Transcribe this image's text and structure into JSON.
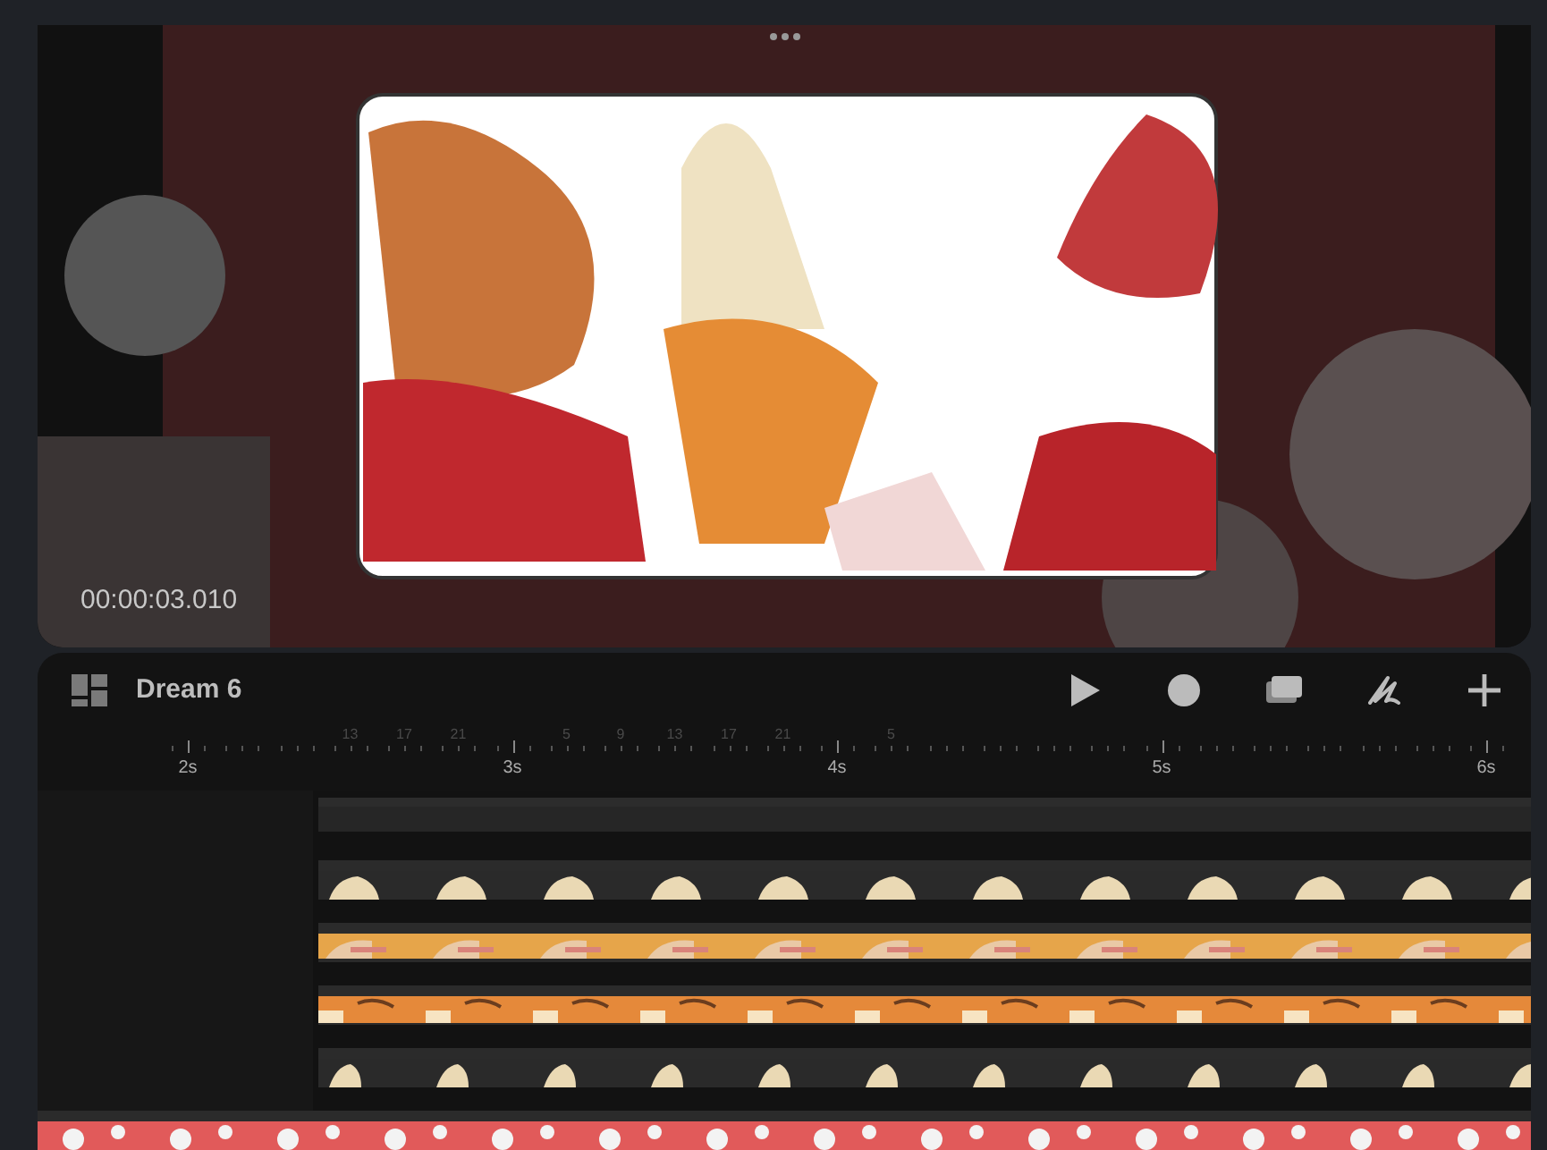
{
  "preview": {
    "timecode": "00:00:03.010"
  },
  "project": {
    "title": "Dream 6"
  },
  "toolbar": [
    {
      "kind": "play"
    },
    {
      "kind": "record"
    },
    {
      "kind": "layers"
    },
    {
      "kind": "draw"
    },
    {
      "kind": "add"
    }
  ],
  "ruler": [
    {
      "kind": "second",
      "label": "2s"
    },
    {
      "kind": "tick"
    },
    {
      "kind": "tick"
    },
    {
      "kind": "frame",
      "label": "13"
    },
    {
      "kind": "frame",
      "label": "17"
    },
    {
      "kind": "frame",
      "label": "21"
    },
    {
      "kind": "second",
      "label": "3s"
    },
    {
      "kind": "frame",
      "label": "5"
    },
    {
      "kind": "frame",
      "label": "9"
    },
    {
      "kind": "frame",
      "label": "13"
    },
    {
      "kind": "frame",
      "label": "17"
    },
    {
      "kind": "frame",
      "label": "21"
    },
    {
      "kind": "second",
      "label": "4s"
    },
    {
      "kind": "frame",
      "label": "5"
    },
    {
      "kind": "tick"
    },
    {
      "kind": "tick"
    },
    {
      "kind": "tick"
    },
    {
      "kind": "tick"
    },
    {
      "kind": "second",
      "label": "5s"
    },
    {
      "kind": "tick"
    },
    {
      "kind": "tick"
    },
    {
      "kind": "tick"
    },
    {
      "kind": "tick"
    },
    {
      "kind": "tick"
    },
    {
      "kind": "second",
      "label": "6s"
    }
  ],
  "tracks": [
    {
      "kind": "bar"
    },
    {
      "kind": "filmstrip"
    },
    {
      "kind": "filmstrip"
    },
    {
      "kind": "filmstrip"
    },
    {
      "kind": "filmstrip"
    },
    {
      "kind": "wide"
    }
  ]
}
